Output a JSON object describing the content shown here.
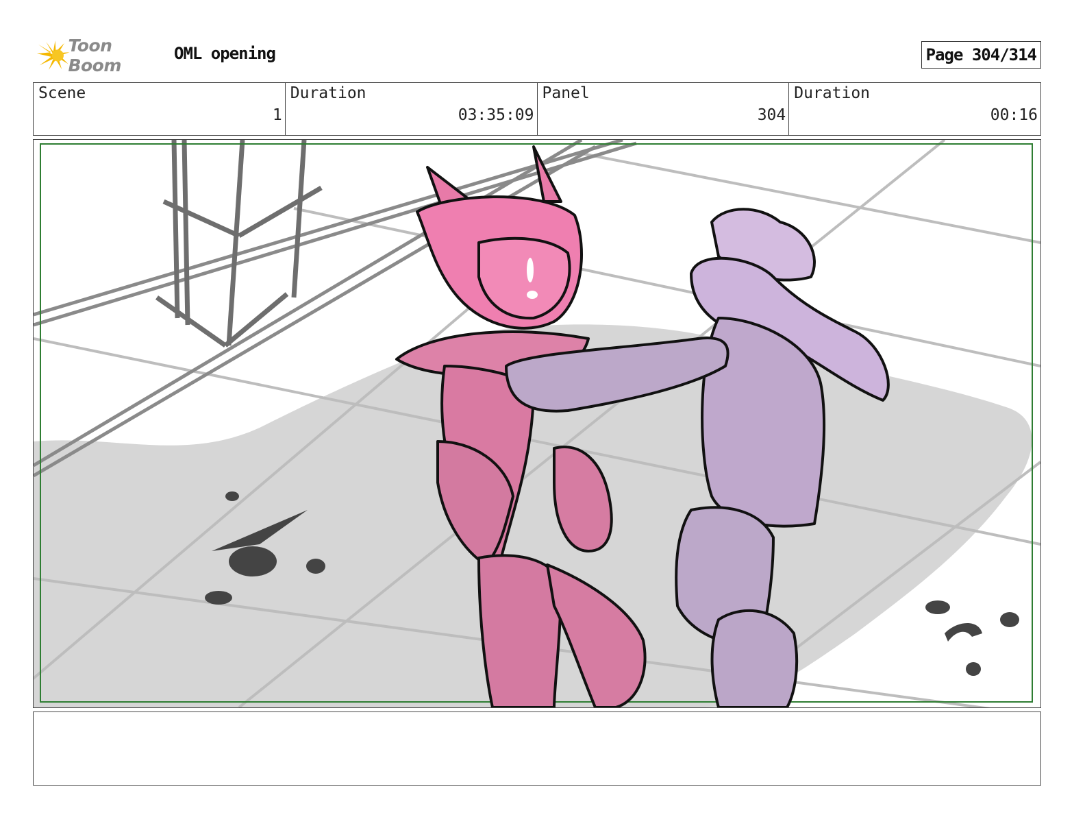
{
  "header": {
    "logo_text": "Toon Boom",
    "project_title": "OML opening",
    "page_label": "Page 304/314"
  },
  "info": {
    "scene_label": "Scene",
    "scene_value": "1",
    "duration_label": "Duration",
    "duration_value": "03:35:09",
    "panel_label": "Panel",
    "panel_value": "304",
    "panel_duration_label": "Duration",
    "panel_duration_value": "00:16"
  },
  "panel": {
    "frame_color": "#2e7d32",
    "pink_character_color": "#e87aa8",
    "purple_character_color": "#bfa8cc",
    "shadow_color": "#d6d6d6"
  },
  "notes": {
    "text": ""
  }
}
